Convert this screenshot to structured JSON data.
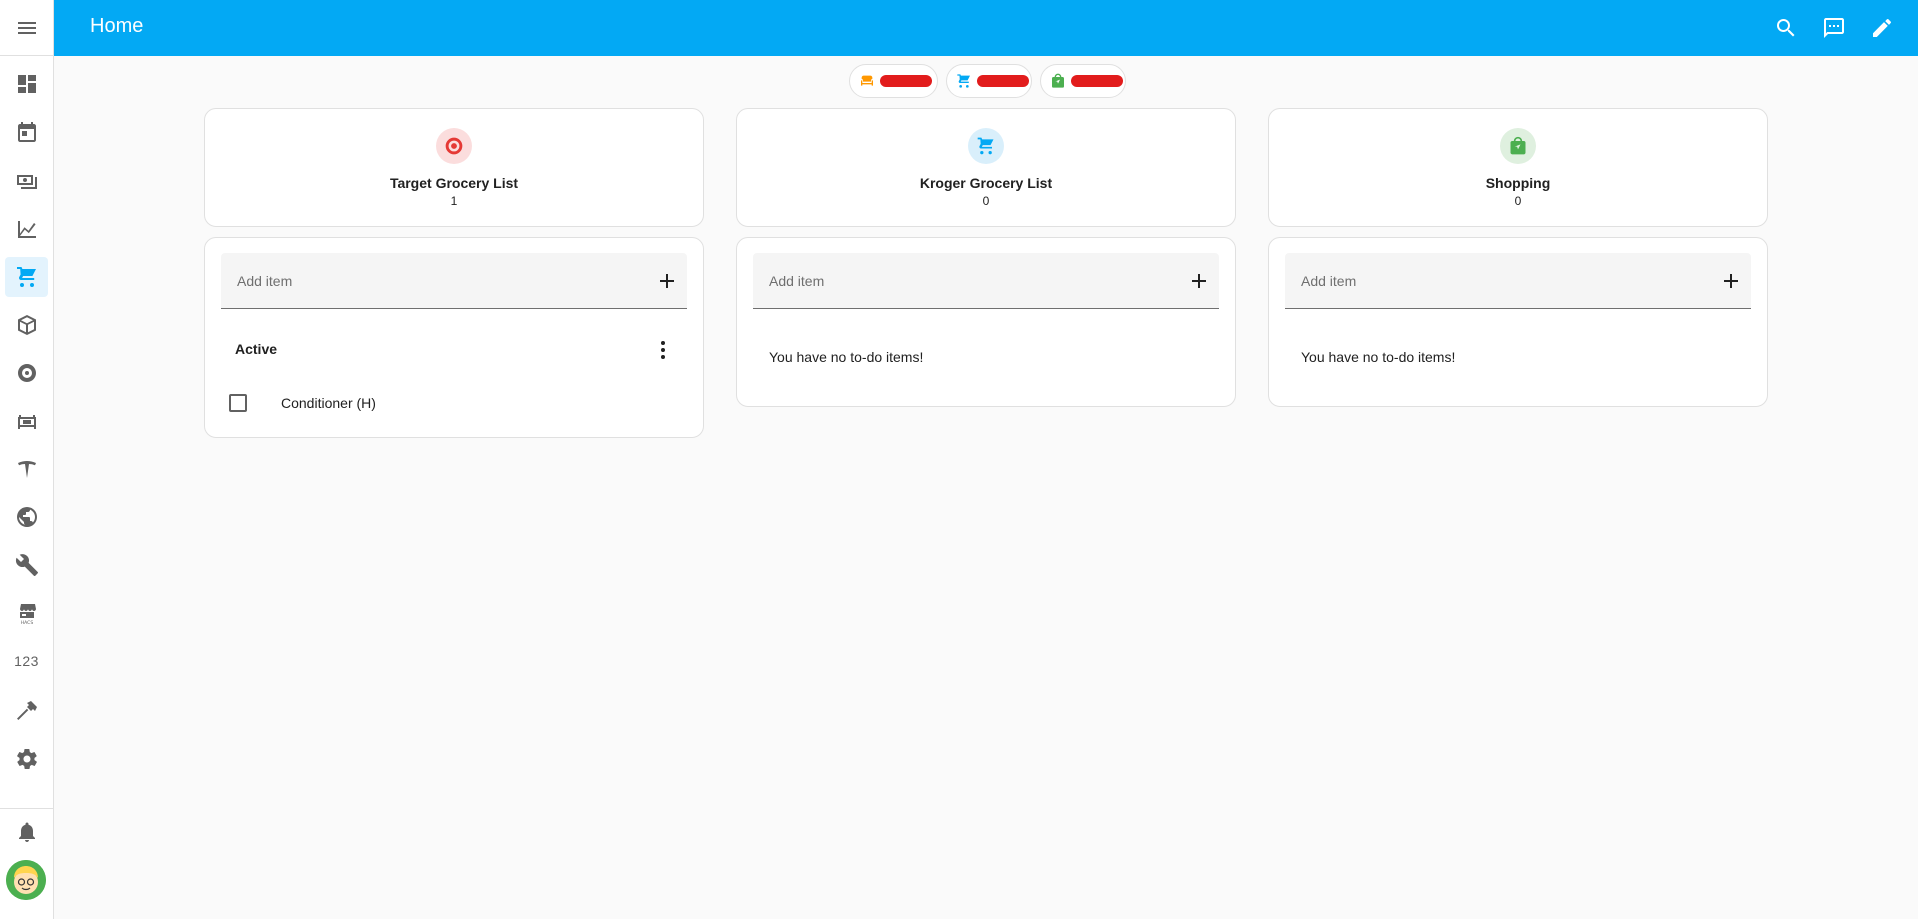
{
  "header": {
    "title": "Home",
    "actions": [
      "search-icon",
      "assist-icon",
      "edit-icon"
    ]
  },
  "sidebar": {
    "items": [
      {
        "icon": "dashboard-icon",
        "active": false
      },
      {
        "icon": "calendar-icon",
        "active": false
      },
      {
        "icon": "finance-icon",
        "active": false
      },
      {
        "icon": "history-icon",
        "active": false
      },
      {
        "icon": "cart-icon",
        "active": true
      },
      {
        "icon": "package-icon",
        "active": false
      },
      {
        "icon": "camera-icon",
        "active": false
      },
      {
        "icon": "bed-icon",
        "active": false
      },
      {
        "icon": "tesla-icon",
        "active": false
      },
      {
        "icon": "globe-icon",
        "active": false
      },
      {
        "icon": "wrench-icon",
        "active": false
      },
      {
        "icon": "hacs-icon",
        "active": false,
        "text": "HACS"
      },
      {
        "icon": "counter-icon",
        "active": false,
        "text": "123"
      },
      {
        "icon": "hammer-icon",
        "active": false
      },
      {
        "icon": "settings-icon",
        "active": false
      }
    ],
    "notifications_icon": "bell-icon",
    "user_avatar": "avatar"
  },
  "badges": [
    {
      "icon": "sofa-icon",
      "color": "#ff9800"
    },
    {
      "icon": "cart-icon",
      "color": "#03a9f4"
    },
    {
      "icon": "shopping-icon",
      "color": "#4caf50"
    }
  ],
  "tiles": [
    {
      "name": "Target Grocery List",
      "count": "1",
      "icon": "target-icon",
      "color": "#e53935",
      "bg": "#fbdddd"
    },
    {
      "name": "Kroger Grocery List",
      "count": "0",
      "icon": "cart-icon",
      "color": "#03a9f4",
      "bg": "#d9effb"
    },
    {
      "name": "Shopping",
      "count": "0",
      "icon": "shopping-icon",
      "color": "#4caf50",
      "bg": "#dff0df"
    }
  ],
  "todo_lists": [
    {
      "add_placeholder": "Add item",
      "section": "Active",
      "items": [
        {
          "label": "Conditioner (H)",
          "checked": false
        }
      ],
      "empty_text": ""
    },
    {
      "add_placeholder": "Add item",
      "section": "",
      "items": [],
      "empty_text": "You have no to-do items!"
    },
    {
      "add_placeholder": "Add item",
      "section": "",
      "items": [],
      "empty_text": "You have no to-do items!"
    }
  ],
  "colors": {
    "header_bg": "#03a9f4",
    "accent": "#03a9f4",
    "badge_redaction": "#e21c1c"
  }
}
